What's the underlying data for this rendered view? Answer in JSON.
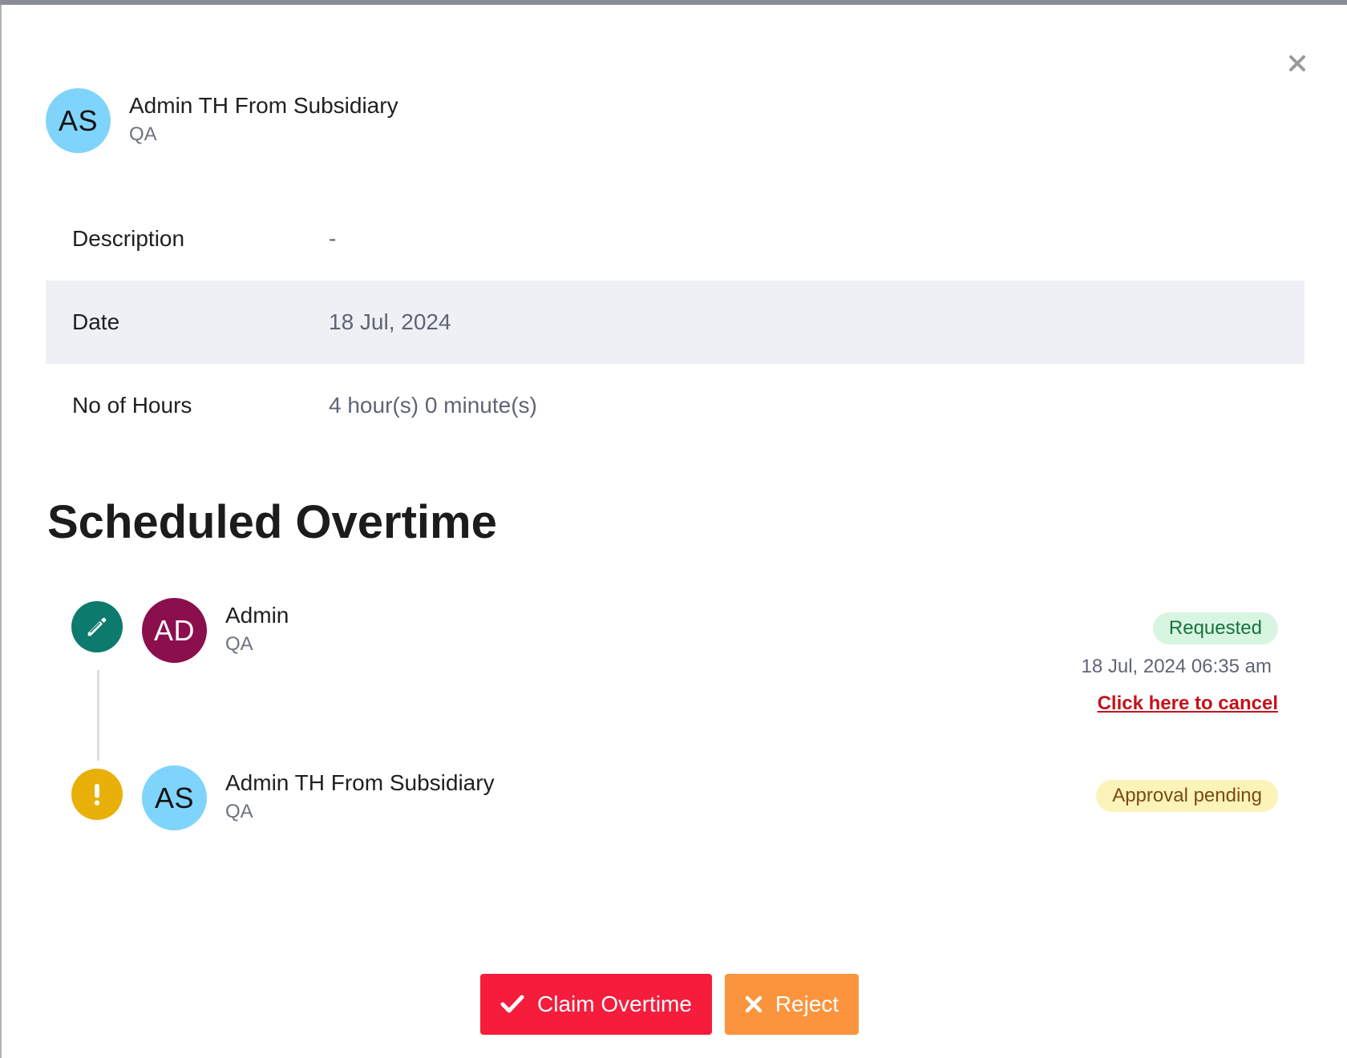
{
  "requester": {
    "initials": "AS",
    "name": "Admin TH From Subsidiary",
    "role": "QA"
  },
  "details": [
    {
      "label": "Description",
      "value": "-"
    },
    {
      "label": "Date",
      "value": "18 Jul, 2024"
    },
    {
      "label": "No of Hours",
      "value": "4 hour(s) 0 minute(s)"
    }
  ],
  "section_title": "Scheduled Overtime",
  "timeline": [
    {
      "icon": "pencil-icon",
      "icon_color": "#0c7a6c",
      "initials": "AD",
      "avatar_color": "#8b0f4d",
      "name": "Admin",
      "role": "QA",
      "status": "Requested",
      "timestamp": "18 Jul, 2024 06:35 am",
      "cancel_label": "Click here to cancel"
    },
    {
      "icon": "exclamation-icon",
      "icon_color": "#e8b008",
      "initials": "AS",
      "avatar_color": "#7fd4fb",
      "name": "Admin TH From Subsidiary",
      "role": "QA",
      "status": "Approval pending"
    }
  ],
  "actions": {
    "claim_label": "Claim Overtime",
    "reject_label": "Reject"
  },
  "colors": {
    "claim_button": "#f51c3c",
    "reject_button": "#fb943c",
    "requested_badge_bg": "#d8f5e1",
    "pending_badge_bg": "#fbf3b8",
    "cancel_link": "#c4121b"
  }
}
